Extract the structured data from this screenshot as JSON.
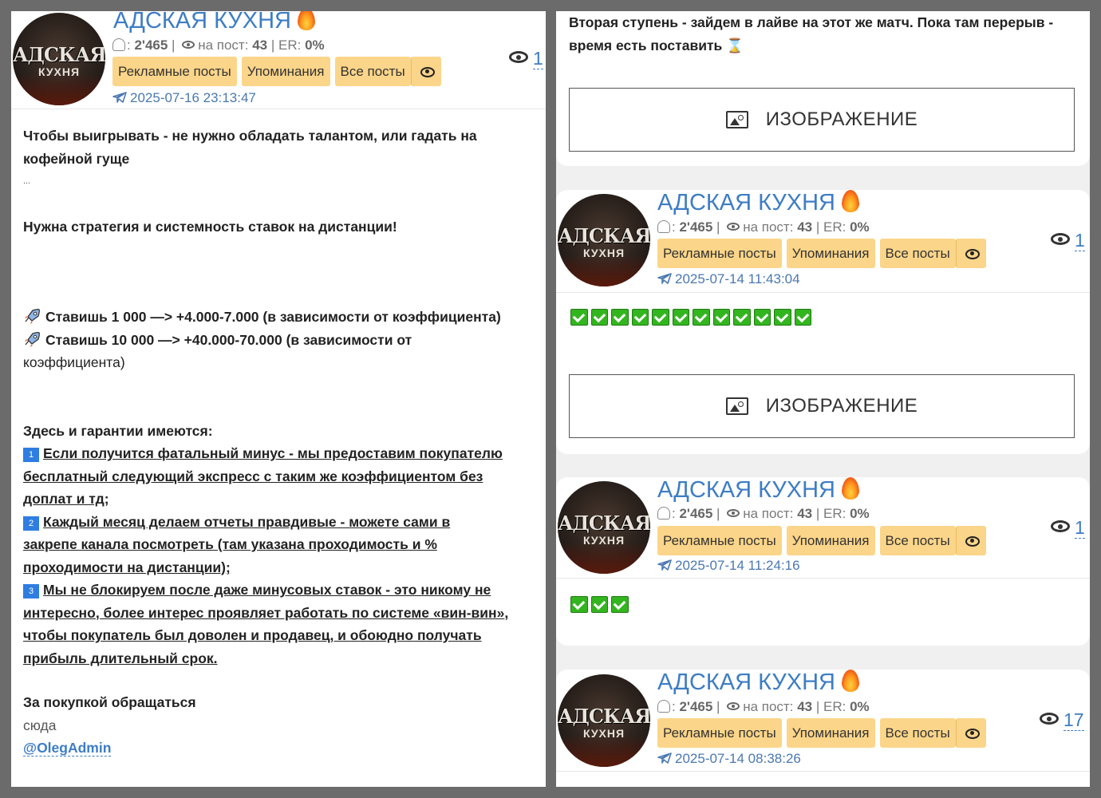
{
  "channel": {
    "title": "АДСКАЯ КУХНЯ",
    "avatar_line1": "АДСКАЯ",
    "avatar_line2": "КУХНЯ",
    "subscribers": "2'465",
    "per_post_label": "на пост:",
    "per_post": "43",
    "er_label": "ER:",
    "er": "0%"
  },
  "buttons": {
    "ads": "Рекламные посты",
    "mentions": "Упоминания",
    "all": "Все посты"
  },
  "image_label": "ИЗОБРАЖЕНИЕ",
  "left_post": {
    "date": "2025-07-16 23:13:47",
    "views": "1",
    "line1": "Чтобы выигрывать - не нужно обладать талантом, или гадать на",
    "line2": "кофейной гуще",
    "ellipsis": "...",
    "line3": "Нужна стратегия и системность ставок на дистанции!",
    "bet1": "Ставишь 1 000 —> +4.000-7.000 (в зависимости от коэффициента)",
    "bet2a": "Ставишь 10 000 —> +40.000-70.000 (в зависимости от",
    "bet2b": "коэффициента)",
    "guarantees": "Здесь и гарантии имеются:",
    "g1_num": "1",
    "g1a": "Если получится фатальный минус - мы предоставим покупателю",
    "g1b": "бесплатный следующий экспресс с таким же коэффициентом без",
    "g1c": "доплат и тд;",
    "g2_num": "2",
    "g2a": "Каждый месяц делаем отчеты правдивые - можете сами в",
    "g2b": "закрепе канала посмотреть (там указана проходимость и %",
    "g2c": "проходимости на дистанции);",
    "g3_num": "3",
    "g3a": "Мы не блокируем после даже минусовых ставок - это никому не",
    "g3b": "интересно, более интерес проявляет работать по системе «вин-вин»,",
    "g3c": "чтобы покупатель был доволен и продавец, и обоюдно получать",
    "g3d": "прибыль длительный срок.",
    "contact": "За покупкой обращаться",
    "here": "сюда",
    "mention": "@OlegAdmin"
  },
  "right_top": {
    "line1": "Вторая ступень - зайдем в лайве на этот же матч. Пока там перерыв -",
    "line2": "время есть поставить ⌛"
  },
  "posts": [
    {
      "date": "2025-07-14 11:43:04",
      "views": "1",
      "checks": 12
    },
    {
      "date": "2025-07-14 11:24:16",
      "views": "1",
      "checks": 3
    },
    {
      "date": "2025-07-14 08:38:26",
      "views": "17"
    }
  ],
  "icons": [
    "subscribers-icon",
    "eye-icon",
    "fire-icon",
    "telegram-plane-icon",
    "rocket-icon",
    "image-icon",
    "check-icon"
  ]
}
